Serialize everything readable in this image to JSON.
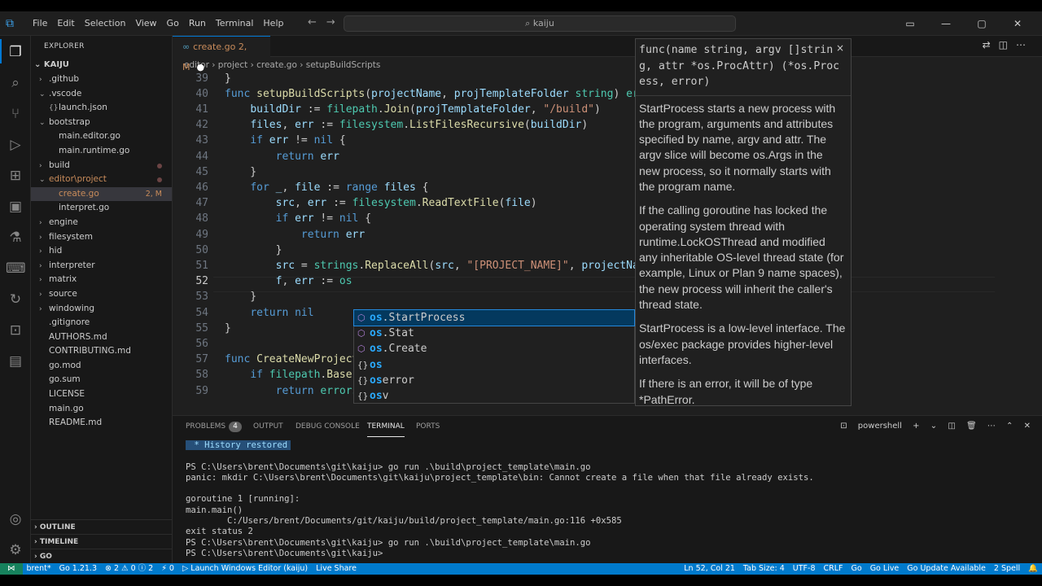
{
  "menu": [
    "File",
    "Edit",
    "Selection",
    "View",
    "Go",
    "Run",
    "Terminal",
    "Help"
  ],
  "search": {
    "text": "kaiju"
  },
  "explorer": {
    "title": "EXPLORER",
    "root": "KAIJU",
    "items": [
      {
        "label": ".github",
        "type": "folder",
        "depth": 1,
        "open": false
      },
      {
        "label": ".vscode",
        "type": "folder",
        "depth": 1,
        "open": true
      },
      {
        "label": "launch.json",
        "type": "file",
        "depth": 2,
        "icon": "{}"
      },
      {
        "label": "bootstrap",
        "type": "folder",
        "depth": 1,
        "open": true
      },
      {
        "label": "main.editor.go",
        "type": "file",
        "depth": 2
      },
      {
        "label": "main.runtime.go",
        "type": "file",
        "depth": 2
      },
      {
        "label": "build",
        "type": "folder",
        "depth": 1,
        "open": false,
        "dot": true
      },
      {
        "label": "editor\\project",
        "type": "folder",
        "depth": 1,
        "open": true,
        "dot": true,
        "git": true
      },
      {
        "label": "create.go",
        "type": "file",
        "depth": 2,
        "badge": "2, M",
        "git": true,
        "selected": true
      },
      {
        "label": "interpret.go",
        "type": "file",
        "depth": 2
      },
      {
        "label": "engine",
        "type": "folder",
        "depth": 1,
        "open": false
      },
      {
        "label": "filesystem",
        "type": "folder",
        "depth": 1,
        "open": false
      },
      {
        "label": "hid",
        "type": "folder",
        "depth": 1,
        "open": false
      },
      {
        "label": "interpreter",
        "type": "folder",
        "depth": 1,
        "open": false
      },
      {
        "label": "matrix",
        "type": "folder",
        "depth": 1,
        "open": false
      },
      {
        "label": "source",
        "type": "folder",
        "depth": 1,
        "open": false
      },
      {
        "label": "windowing",
        "type": "folder",
        "depth": 1,
        "open": false
      },
      {
        "label": ".gitignore",
        "type": "file",
        "depth": 1
      },
      {
        "label": "AUTHORS.md",
        "type": "file",
        "depth": 1
      },
      {
        "label": "CONTRIBUTING.md",
        "type": "file",
        "depth": 1
      },
      {
        "label": "go.mod",
        "type": "file",
        "depth": 1
      },
      {
        "label": "go.sum",
        "type": "file",
        "depth": 1
      },
      {
        "label": "LICENSE",
        "type": "file",
        "depth": 1
      },
      {
        "label": "main.go",
        "type": "file",
        "depth": 1
      },
      {
        "label": "README.md",
        "type": "file",
        "depth": 1
      }
    ],
    "sections": [
      "OUTLINE",
      "TIMELINE",
      "GO"
    ]
  },
  "tab": {
    "label": "create.go",
    "badge": "2, M"
  },
  "breadcrumb": [
    "editor",
    "project",
    "create.go",
    "setupBuildScripts"
  ],
  "code_lines": [
    {
      "n": "39",
      "html": "<span class='p'>}</span>"
    },
    {
      "n": "40",
      "html": "<span class='k'>func</span> <span class='f'>setupBuildScripts</span>(<span class='v'>projectName</span>, <span class='v'>projTemplateFolder</span> <span class='t'>string</span>) <span class='t'>error</span> {"
    },
    {
      "n": "41",
      "html": "    <span class='v'>buildDir</span> := <span class='t'>filepath</span>.<span class='f'>Join</span>(<span class='v'>projTemplateFolder</span>, <span class='s'>\"/build\"</span>)"
    },
    {
      "n": "42",
      "html": "    <span class='v'>files</span>, <span class='v'>err</span> := <span class='t'>filesystem</span>.<span class='f'>ListFilesRecursive</span>(<span class='v'>buildDir</span>)"
    },
    {
      "n": "43",
      "html": "    <span class='k'>if</span> <span class='v'>err</span> != <span class='k'>nil</span> {"
    },
    {
      "n": "44",
      "html": "        <span class='k'>return</span> <span class='v'>err</span>"
    },
    {
      "n": "45",
      "html": "    }"
    },
    {
      "n": "46",
      "html": "    <span class='k'>for</span> <span class='v'>_</span>, <span class='v'>file</span> := <span class='k'>range</span> <span class='v'>files</span> {"
    },
    {
      "n": "47",
      "html": "        <span class='v'>src</span>, <span class='v'>err</span> := <span class='t'>filesystem</span>.<span class='f'>ReadTextFile</span>(<span class='v'>file</span>)"
    },
    {
      "n": "48",
      "html": "        <span class='k'>if</span> <span class='v'>err</span> != <span class='k'>nil</span> {"
    },
    {
      "n": "49",
      "html": "            <span class='k'>return</span> <span class='v'>err</span>"
    },
    {
      "n": "50",
      "html": "        }"
    },
    {
      "n": "51",
      "html": "        <span class='v'>src</span> = <span class='t'>strings</span>.<span class='f'>ReplaceAll</span>(<span class='v'>src</span>, <span class='s'>\"[PROJECT_NAME]\"</span>, <span class='v'>projectName</span>)"
    },
    {
      "n": "52",
      "html": "        <span class='v'>f</span>, <span class='v'>err</span> := <span class='t'>os</span>"
    },
    {
      "n": "53",
      "html": "    }"
    },
    {
      "n": "54",
      "html": "    <span class='k'>return</span> <span class='k'>nil</span>"
    },
    {
      "n": "55",
      "html": "}"
    },
    {
      "n": "56",
      "html": ""
    },
    {
      "n": "57",
      "html": "<span class='k'>func</span> <span class='f'>CreateNewProject</span>(<span class='v'>name</span>, <span class='v'>path</span> <span class='t'>string</span>) <span class='t'>error</span> {"
    },
    {
      "n": "58",
      "html": "    <span class='k'>if</span> <span class='t'>filepath</span>.<span class='f'>Base</span>(<span class='v'>path</span>) != <span class='v'>name</span> {"
    },
    {
      "n": "59",
      "html": "        <span class='k'>return</span> <span class='t'>errors</span>.<span class='f'>New</span>(<span class='s'>\"project name and path do not match\"</span>)"
    }
  ],
  "autocomplete": [
    {
      "kind": "function",
      "prefix": "os",
      "rest": ".StartProcess"
    },
    {
      "kind": "function",
      "prefix": "os",
      "rest": ".Stat"
    },
    {
      "kind": "function",
      "prefix": "os",
      "rest": ".Create"
    },
    {
      "kind": "module",
      "prefix": "os",
      "rest": ""
    },
    {
      "kind": "module",
      "prefix": "os",
      "rest": "error"
    },
    {
      "kind": "module",
      "prefix": "os",
      "rest": "v"
    }
  ],
  "hover": {
    "signature": "func(name string, argv []string, attr *os.ProcAttr) (*os.Process, error)",
    "paragraphs": [
      "StartProcess starts a new process with the program, arguments and attributes specified by name, argv and attr. The argv slice will become os.Args in the new process, so it normally starts with the program name.",
      "If the calling goroutine has locked the operating system thread with runtime.LockOSThread and modified any inheritable OS-level thread state (for example, Linux or Plan 9 name spaces), the new process will inherit the caller's thread state.",
      "StartProcess is a low-level interface. The os/exec package provides higher-level interfaces.",
      "If there is an error, it will be of type *PathError."
    ]
  },
  "panel": {
    "tabs": [
      "PROBLEMS",
      "OUTPUT",
      "DEBUG CONSOLE",
      "TERMINAL",
      "PORTS"
    ],
    "problems_count": "4",
    "shell": "powershell",
    "history": "History restored",
    "terminal_lines": [
      "",
      "PS C:\\Users\\brent\\Documents\\git\\kaiju> go run .\\build\\project_template\\main.go",
      "panic: mkdir C:\\Users\\brent\\Documents\\git\\kaiju\\project_template\\bin: Cannot create a file when that file already exists.",
      "",
      "goroutine 1 [running]:",
      "main.main()",
      "        C:/Users/brent/Documents/git/kaiju/build/project_template/main.go:116 +0x585",
      "exit status 2",
      "PS C:\\Users\\brent\\Documents\\git\\kaiju> go run .\\build\\project_template\\main.go",
      "PS C:\\Users\\brent\\Documents\\git\\kaiju> "
    ]
  },
  "status": {
    "left": [
      "brent*",
      "Go 1.21.3",
      "⊗ 2 ⚠ 0 ⓘ 2",
      "⚡ 0",
      "▷ Launch Windows Editor (kaiju)",
      "Live Share"
    ],
    "right": [
      "Ln 52, Col 21",
      "Tab Size: 4",
      "UTF-8",
      "CRLF",
      "Go",
      "Go Live",
      "Go Update Available",
      "2 Spell"
    ]
  },
  "colors": {
    "accent": "#007acc",
    "keyword": "#569cd6",
    "function": "#dcdcaa",
    "variable": "#9cdcfe",
    "string": "#ce9178",
    "type": "#4ec9b0"
  }
}
